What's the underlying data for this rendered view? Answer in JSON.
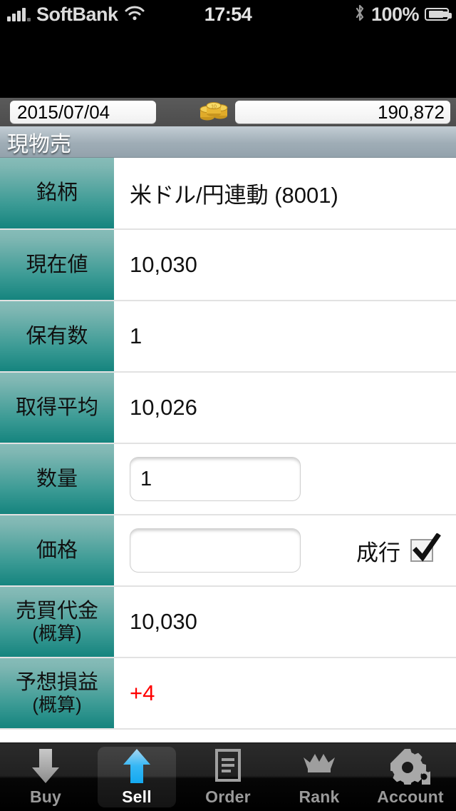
{
  "status_bar": {
    "carrier": "SoftBank",
    "wifi_icon": "wifi-icon",
    "time": "17:54",
    "bluetooth_icon": "bluetooth-icon",
    "battery_percent": "100%",
    "battery_icon": "battery-charging-icon",
    "signal_icon": "signal-bars-icon"
  },
  "info_bar": {
    "date": "2015/07/04",
    "coins_icon": "coins-icon",
    "balance": "190,872"
  },
  "title_bar": {
    "title": "現物売"
  },
  "form": {
    "rows": [
      {
        "label": "銘柄",
        "sublabel": "",
        "value": "米ドル/円連動 (8001)",
        "type": "text"
      },
      {
        "label": "現在値",
        "sublabel": "",
        "value": "10,030",
        "type": "text"
      },
      {
        "label": "保有数",
        "sublabel": "",
        "value": "1",
        "type": "text"
      },
      {
        "label": "取得平均",
        "sublabel": "",
        "value": "10,026",
        "type": "text"
      },
      {
        "label": "数量",
        "sublabel": "",
        "value": "1",
        "type": "input"
      },
      {
        "label": "価格",
        "sublabel": "",
        "value": "",
        "type": "input-market"
      },
      {
        "label": "売買代金",
        "sublabel": "(概算)",
        "value": "10,030",
        "type": "text"
      },
      {
        "label": "予想損益",
        "sublabel": "(概算)",
        "value": "+4",
        "type": "text-red"
      }
    ],
    "market_order": {
      "label": "成行",
      "checked": true,
      "check_icon": "checkmark-icon"
    }
  },
  "colors": {
    "label_gradient_top": "#86bcb8",
    "label_gradient_bottom": "#15847e",
    "profit_red": "#ff0000",
    "sell_arrow_blue": "#35b7f5",
    "titlebar_gray": "#9fadb6"
  },
  "tab_bar": {
    "tabs": [
      {
        "label": "Buy",
        "icon": "arrow-down-icon",
        "active": false
      },
      {
        "label": "Sell",
        "icon": "arrow-up-icon",
        "active": true
      },
      {
        "label": "Order",
        "icon": "document-icon",
        "active": false
      },
      {
        "label": "Rank",
        "icon": "crown-icon",
        "active": false
      },
      {
        "label": "Account",
        "icon": "gears-icon",
        "active": false
      }
    ]
  }
}
